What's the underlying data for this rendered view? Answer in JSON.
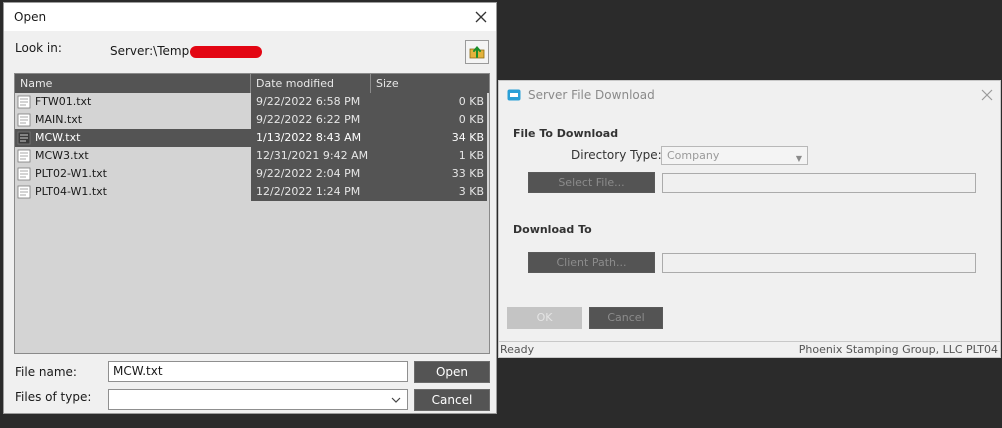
{
  "open_dialog": {
    "title": "Open",
    "look_in_label": "Look in:",
    "look_in_value": "Server:\\Temp",
    "columns": {
      "name": "Name",
      "date": "Date modified",
      "size": "Size"
    },
    "files": [
      {
        "name": "FTW01.txt",
        "date": "9/22/2022 6:58 PM",
        "size": "0 KB",
        "selected": false
      },
      {
        "name": "MAIN.txt",
        "date": "9/22/2022 6:22 PM",
        "size": "0 KB",
        "selected": false
      },
      {
        "name": "MCW.txt",
        "date": "1/13/2022 8:43 AM",
        "size": "34 KB",
        "selected": true
      },
      {
        "name": "MCW3.txt",
        "date": "12/31/2021 9:42 AM",
        "size": "1 KB",
        "selected": false
      },
      {
        "name": "PLT02-W1.txt",
        "date": "9/22/2022 2:04 PM",
        "size": "33 KB",
        "selected": false
      },
      {
        "name": "PLT04-W1.txt",
        "date": "12/2/2022 1:24 PM",
        "size": "3 KB",
        "selected": false
      }
    ],
    "file_name_label": "File name:",
    "file_name_value": "MCW.txt",
    "files_of_type_label": "Files of type:",
    "files_of_type_value": "",
    "open_button": "Open",
    "cancel_button": "Cancel"
  },
  "server_dialog": {
    "title": "Server File Download",
    "file_to_download_label": "File To Download",
    "directory_type_label": "Directory Type:",
    "directory_type_value": "Company",
    "select_file_button": "Select File...",
    "download_to_label": "Download To",
    "client_path_button": "Client Path...",
    "ok_button": "OK",
    "cancel_button": "Cancel",
    "status_left": "Ready",
    "status_right": "Phoenix Stamping Group, LLC  PLT04"
  }
}
